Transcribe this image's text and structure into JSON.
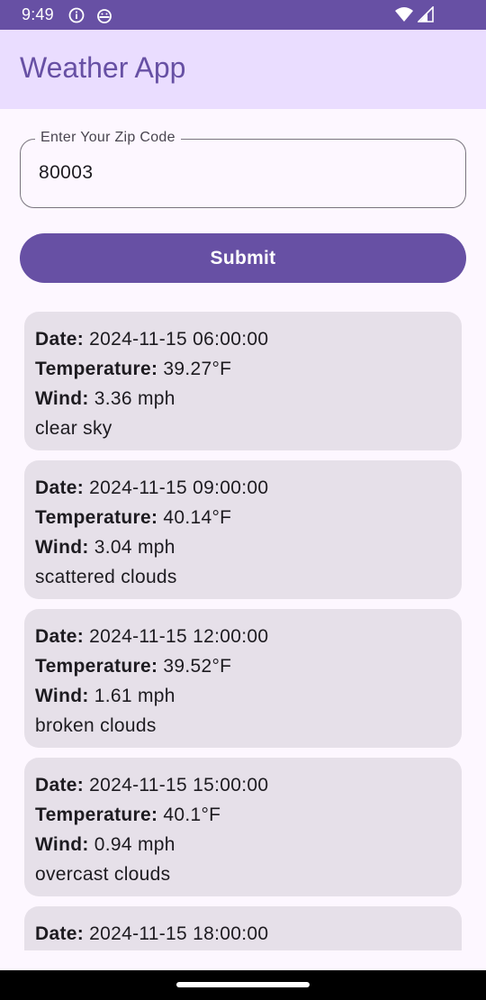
{
  "status_bar": {
    "time": "9:49",
    "icons": [
      "info-icon",
      "android-icon",
      "wifi-icon",
      "signal-icon"
    ]
  },
  "app_bar": {
    "title": "Weather App"
  },
  "zip_field": {
    "label": "Enter Your Zip Code",
    "value": "80003"
  },
  "submit": {
    "label": "Submit"
  },
  "labels": {
    "date": "Date:",
    "temperature": "Temperature:",
    "wind": "Wind:"
  },
  "forecasts": [
    {
      "date": "2024-11-15 06:00:00",
      "temperature": "39.27°F",
      "wind": "3.36 mph",
      "description": "clear sky"
    },
    {
      "date": "2024-11-15 09:00:00",
      "temperature": "40.14°F",
      "wind": "3.04 mph",
      "description": "scattered clouds"
    },
    {
      "date": "2024-11-15 12:00:00",
      "temperature": "39.52°F",
      "wind": "1.61 mph",
      "description": "broken clouds"
    },
    {
      "date": "2024-11-15 15:00:00",
      "temperature": "40.1°F",
      "wind": "0.94 mph",
      "description": "overcast clouds"
    },
    {
      "date": "2024-11-15 18:00:00"
    }
  ],
  "colors": {
    "primary": "#6750a4",
    "app_bar_bg": "#eaddff",
    "card_bg": "#e6e0e9",
    "page_bg": "#fdf7ff"
  }
}
